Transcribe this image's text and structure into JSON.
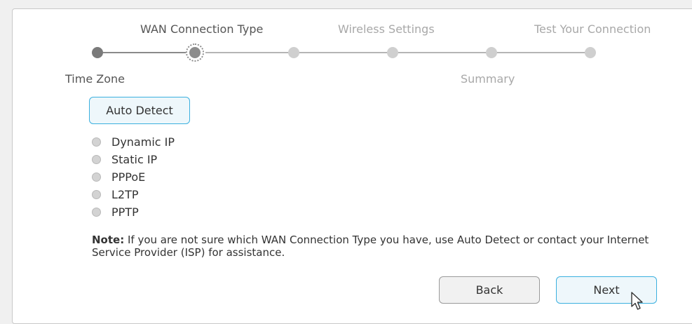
{
  "steps_top": [
    {
      "label": "WAN Connection Type"
    },
    {
      "label": "Wireless Settings"
    },
    {
      "label": "Test Your Connection"
    }
  ],
  "steps_bottom": [
    {
      "label": "Time Zone"
    },
    {
      "label": "Summary"
    }
  ],
  "auto_detect_label": "Auto Detect",
  "connection_types": [
    {
      "label": "Dynamic IP"
    },
    {
      "label": "Static IP"
    },
    {
      "label": "PPPoE"
    },
    {
      "label": "L2TP"
    },
    {
      "label": "PPTP"
    }
  ],
  "note": {
    "prefix": "Note:",
    "text": " If you are not sure which WAN Connection Type you have, use Auto Detect or contact your Internet Service Provider (ISP) for assistance."
  },
  "buttons": {
    "back": "Back",
    "next": "Next"
  },
  "colors": {
    "accent": "#3bb0df",
    "step_active": "#555555",
    "step_inactive": "#a8a8a8"
  },
  "icons": {
    "cursor": "mouse-pointer-icon"
  }
}
